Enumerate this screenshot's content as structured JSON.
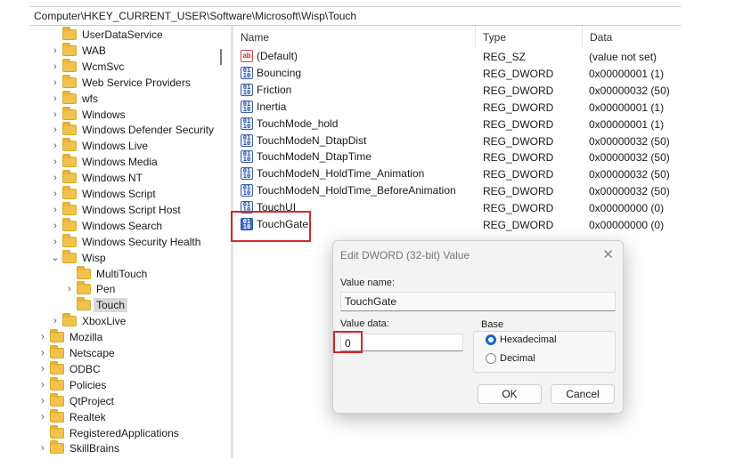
{
  "address_bar": "Computer\\HKEY_CURRENT_USER\\Software\\Microsoft\\Wisp\\Touch",
  "tree": [
    {
      "label": "UserDataService",
      "chev": "",
      "indent": 1
    },
    {
      "label": "WAB",
      "chev": ">",
      "indent": 1
    },
    {
      "label": "WcmSvc",
      "chev": ">",
      "indent": 1
    },
    {
      "label": "Web Service Providers",
      "chev": ">",
      "indent": 1
    },
    {
      "label": "wfs",
      "chev": ">",
      "indent": 1
    },
    {
      "label": "Windows",
      "chev": ">",
      "indent": 1
    },
    {
      "label": "Windows Defender Security Center",
      "chev": ">",
      "indent": 1
    },
    {
      "label": "Windows Live",
      "chev": ">",
      "indent": 1
    },
    {
      "label": "Windows Media",
      "chev": ">",
      "indent": 1
    },
    {
      "label": "Windows NT",
      "chev": ">",
      "indent": 1
    },
    {
      "label": "Windows Script",
      "chev": ">",
      "indent": 1
    },
    {
      "label": "Windows Script Host",
      "chev": ">",
      "indent": 1
    },
    {
      "label": "Windows Search",
      "chev": ">",
      "indent": 1
    },
    {
      "label": "Windows Security Health",
      "chev": ">",
      "indent": 1
    },
    {
      "label": "Wisp",
      "chev": "v",
      "indent": 1
    },
    {
      "label": "MultiTouch",
      "chev": "",
      "indent": 2
    },
    {
      "label": "Pen",
      "chev": ">",
      "indent": 2
    },
    {
      "label": "Touch",
      "chev": "",
      "indent": 2,
      "selected": true
    },
    {
      "label": "XboxLive",
      "chev": ">",
      "indent": 1
    },
    {
      "label": "Mozilla",
      "chev": ">",
      "indent": 0
    },
    {
      "label": "Netscape",
      "chev": ">",
      "indent": 0
    },
    {
      "label": "ODBC",
      "chev": ">",
      "indent": 0
    },
    {
      "label": "Policies",
      "chev": ">",
      "indent": 0
    },
    {
      "label": "QtProject",
      "chev": ">",
      "indent": 0
    },
    {
      "label": "Realtek",
      "chev": ">",
      "indent": 0
    },
    {
      "label": "RegisteredApplications",
      "chev": "",
      "indent": 0
    },
    {
      "label": "SkillBrains",
      "chev": ">",
      "indent": 0
    }
  ],
  "list": {
    "headers": {
      "name": "Name",
      "type": "Type",
      "data": "Data"
    },
    "rows": [
      {
        "name": "(Default)",
        "type": "REG_SZ",
        "data": "(value not set)",
        "icon": "string-value-icon"
      },
      {
        "name": "Bouncing",
        "type": "REG_DWORD",
        "data": "0x00000001 (1)",
        "icon": "dword-value-icon"
      },
      {
        "name": "Friction",
        "type": "REG_DWORD",
        "data": "0x00000032 (50)",
        "icon": "dword-value-icon"
      },
      {
        "name": "Inertia",
        "type": "REG_DWORD",
        "data": "0x00000001 (1)",
        "icon": "dword-value-icon"
      },
      {
        "name": "TouchMode_hold",
        "type": "REG_DWORD",
        "data": "0x00000001 (1)",
        "icon": "dword-value-icon"
      },
      {
        "name": "TouchModeN_DtapDist",
        "type": "REG_DWORD",
        "data": "0x00000032 (50)",
        "icon": "dword-value-icon"
      },
      {
        "name": "TouchModeN_DtapTime",
        "type": "REG_DWORD",
        "data": "0x00000032 (50)",
        "icon": "dword-value-icon"
      },
      {
        "name": "TouchModeN_HoldTime_Animation",
        "type": "REG_DWORD",
        "data": "0x00000032 (50)",
        "icon": "dword-value-icon"
      },
      {
        "name": "TouchModeN_HoldTime_BeforeAnimation",
        "type": "REG_DWORD",
        "data": "0x00000032 (50)",
        "icon": "dword-value-icon"
      },
      {
        "name": "TouchUI",
        "type": "REG_DWORD",
        "data": "0x00000000 (0)",
        "icon": "dword-value-icon"
      },
      {
        "name": "TouchGate",
        "type": "REG_DWORD",
        "data": "0x00000000 (0)",
        "icon": "dword-value-icon",
        "selected": true
      }
    ]
  },
  "dialog": {
    "title": "Edit DWORD (32-bit) Value",
    "close_glyph": "✕",
    "value_name_label": "Value name:",
    "value_name": "TouchGate",
    "value_data_label": "Value data:",
    "value_data": "0",
    "base_label": "Base",
    "base_options": [
      {
        "label": "Hexadecimal",
        "selected": true
      },
      {
        "label": "Decimal",
        "selected": false
      }
    ],
    "ok_label": "OK",
    "cancel_label": "Cancel"
  },
  "colors": {
    "highlight_red": "#d2282a",
    "folder_yellow": "#f0c34a",
    "radio_blue": "#1a64c8"
  }
}
